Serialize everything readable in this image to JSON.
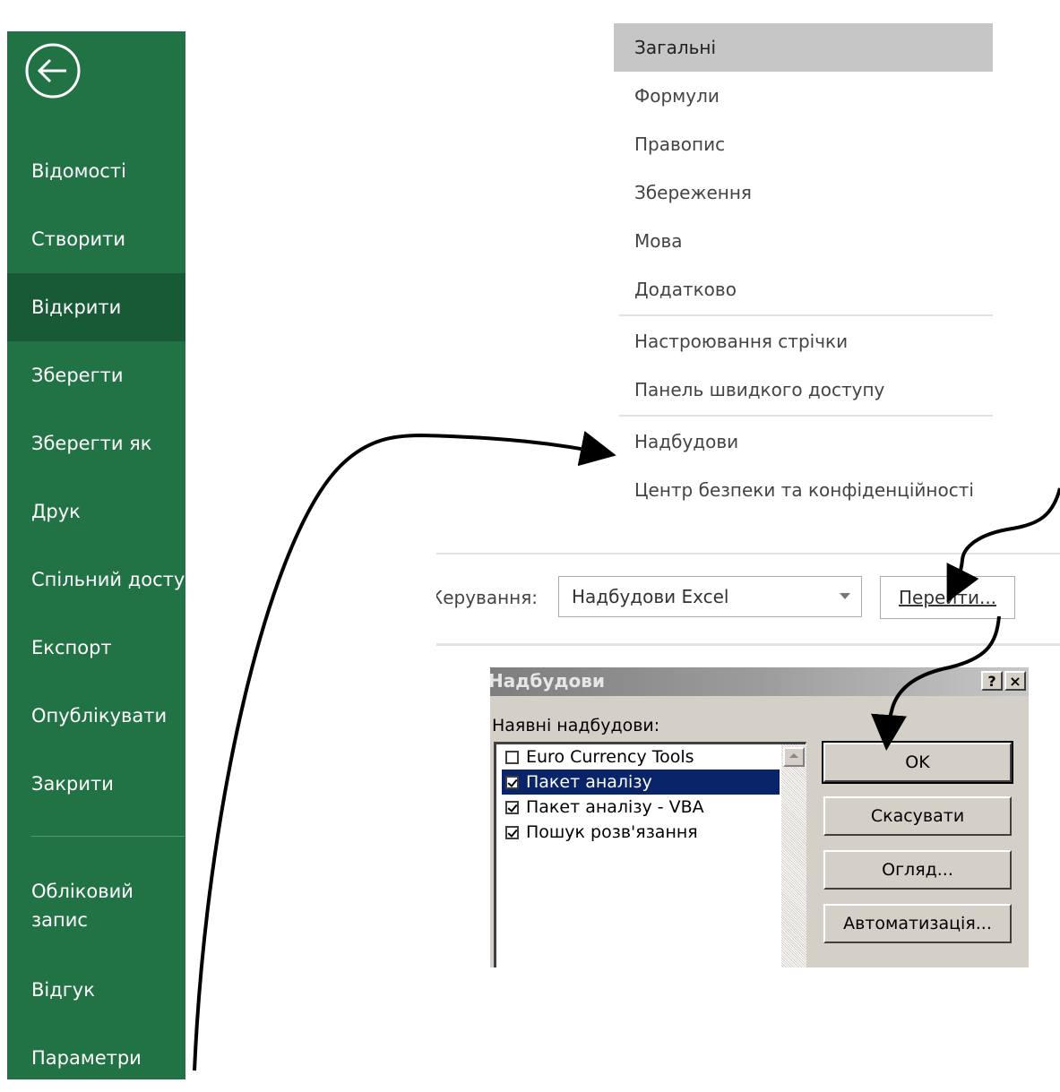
{
  "sidebar": {
    "items": [
      {
        "label": "Відомості"
      },
      {
        "label": "Створити"
      },
      {
        "label": "Відкрити"
      },
      {
        "label": "Зберегти"
      },
      {
        "label": "Зберегти як"
      },
      {
        "label": "Друк"
      },
      {
        "label": "Спільний доступ"
      },
      {
        "label": "Експорт"
      },
      {
        "label": "Опублікувати"
      },
      {
        "label": "Закрити"
      },
      {
        "label": "Обліковий запис"
      },
      {
        "label": "Відгук"
      },
      {
        "label": "Параметри"
      }
    ],
    "active_item": "Відкрити",
    "accent_color": "#217346",
    "active_color": "#185a35"
  },
  "options_categories": {
    "items": [
      {
        "label": "Загальні"
      },
      {
        "label": "Формули"
      },
      {
        "label": "Правопис"
      },
      {
        "label": "Збереження"
      },
      {
        "label": "Мова"
      },
      {
        "label": "Додатково"
      },
      {
        "label": "Настроювання стрічки"
      },
      {
        "label": "Панель швидкого доступу"
      },
      {
        "label": "Надбудови"
      },
      {
        "label": "Центр безпеки та конфіденційності"
      }
    ],
    "selected_item": "Загальні"
  },
  "manage": {
    "label": "Керування:",
    "selected_value": "Надбудови Excel",
    "go_button": "Перейти..."
  },
  "addins_dialog": {
    "title": "Надбудови",
    "help_button": "?",
    "close_button": "×",
    "available_label": "Наявні надбудови:",
    "addins": [
      {
        "label": "Euro Currency Tools",
        "checked": false
      },
      {
        "label": "Пакет аналізу",
        "checked": true
      },
      {
        "label": "Пакет аналізу - VBA",
        "checked": true
      },
      {
        "label": "Пошук розв'язання",
        "checked": true
      }
    ],
    "selected_addin": "Пакет аналізу",
    "buttons": {
      "ok": "OK",
      "cancel": "Скасувати",
      "browse": "Огляд...",
      "automation": "Автоматизація..."
    }
  }
}
